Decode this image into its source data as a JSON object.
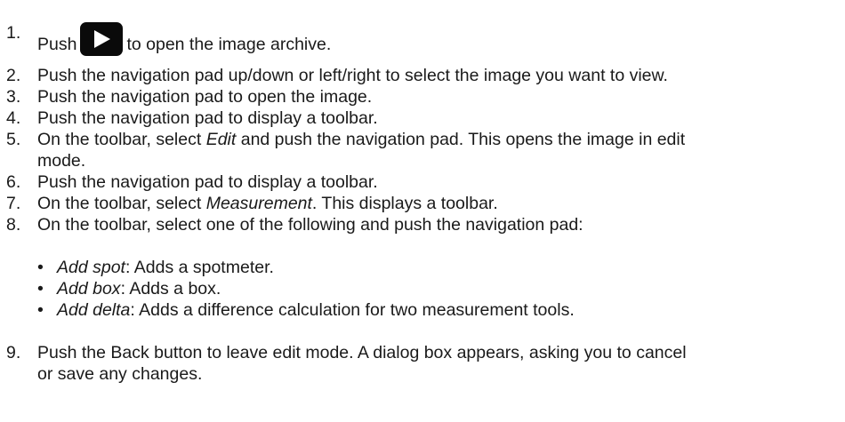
{
  "steps": [
    {
      "num": "1.",
      "before": "Push",
      "icon": "play-icon",
      "after": "to open the image archive."
    },
    {
      "num": "2.",
      "text": "Push the navigation pad up/down or left/right to select the image you want to view."
    },
    {
      "num": "3.",
      "text": "Push the navigation pad to open the image."
    },
    {
      "num": "4.",
      "text": "Push the navigation pad to display a toolbar."
    },
    {
      "num": "5.",
      "before": "On the toolbar, select ",
      "em": "Edit",
      "after": " and push the navigation pad. This opens the image in edit",
      "line2": "mode."
    },
    {
      "num": "6.",
      "text": "Push the navigation pad to display a toolbar."
    },
    {
      "num": "7.",
      "before": "On the toolbar, select ",
      "em": "Measurement",
      "after": ". This displays a toolbar."
    },
    {
      "num": "8.",
      "text": "On the toolbar, select one of the following and push the navigation pad:"
    },
    {
      "num": "9.",
      "text": "Push the Back button to leave edit mode. A dialog box appears, asking you to cancel",
      "line2": "or save any changes."
    }
  ],
  "bullets": [
    {
      "marker": "•",
      "em": "Add spot",
      "rest": ": Adds a spotmeter."
    },
    {
      "marker": "•",
      "em": "Add box",
      "rest": ": Adds a box."
    },
    {
      "marker": "•",
      "em": "Add delta",
      "rest": ": Adds a difference calculation for two measurement tools."
    }
  ]
}
